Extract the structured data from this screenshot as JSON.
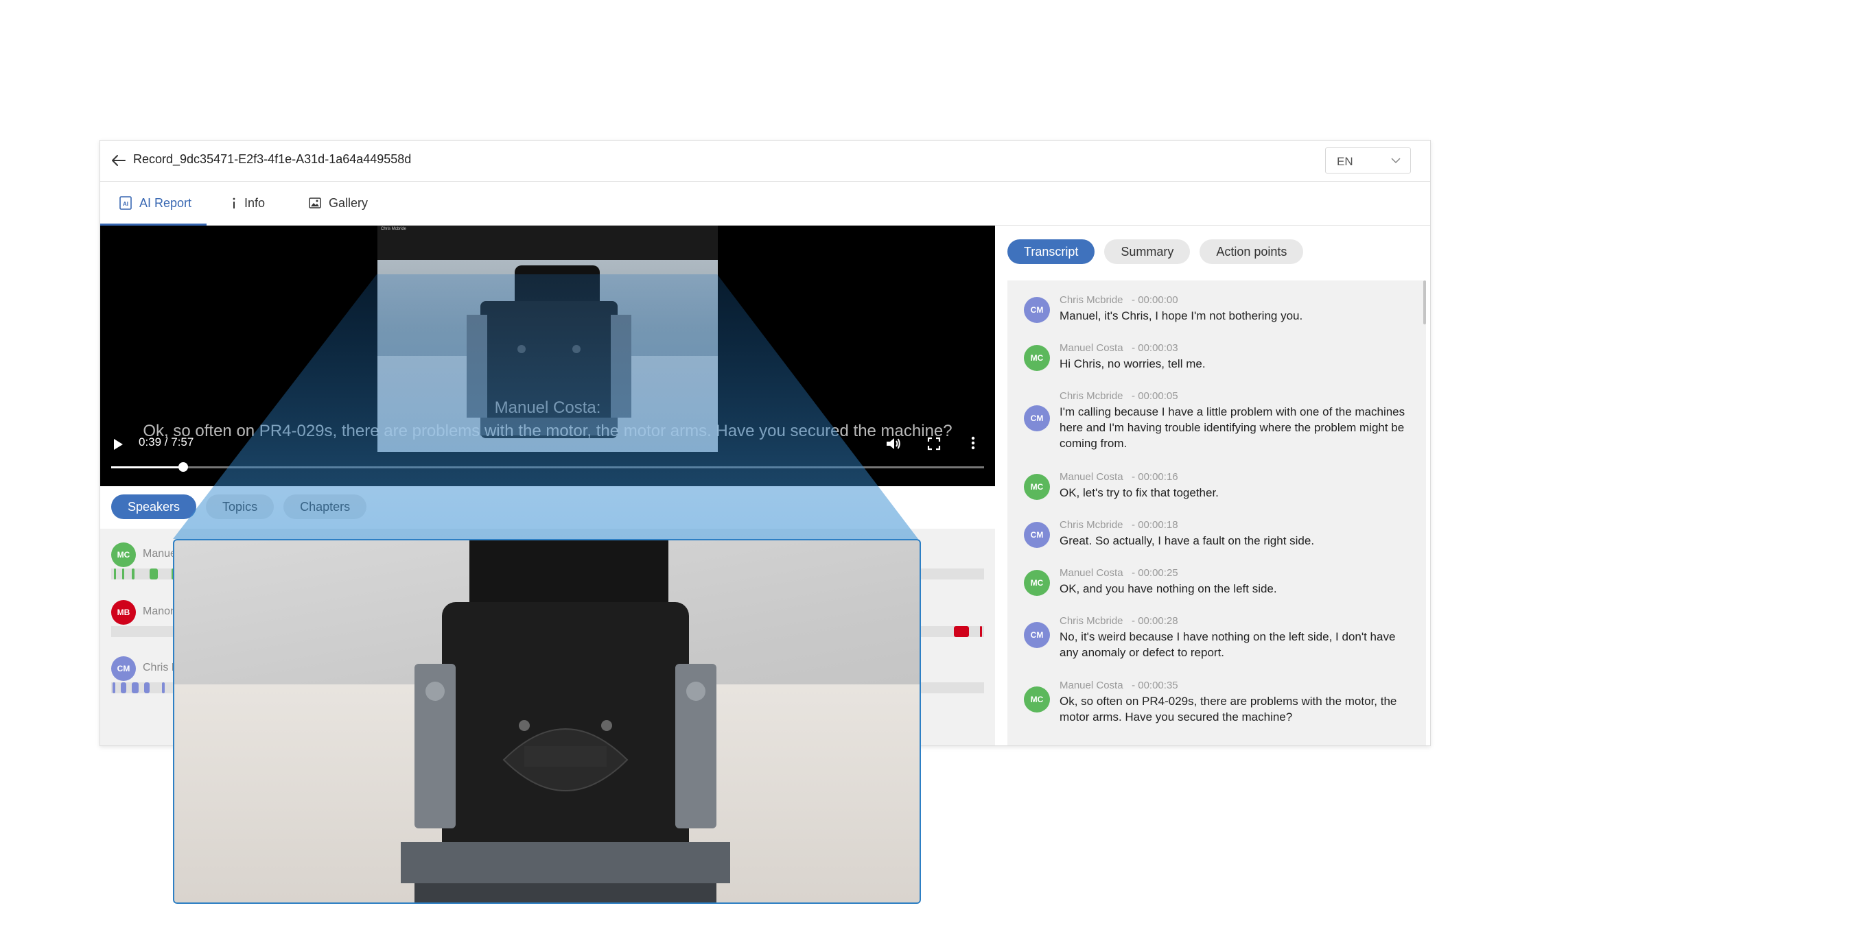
{
  "header": {
    "record_title": "Record_9dc35471-E2f3-4f1e-A31d-1a64a449558d",
    "language": "EN"
  },
  "tabs": [
    {
      "label": "AI Report",
      "icon": "ai-report-icon",
      "active": true
    },
    {
      "label": "Info",
      "icon": "info-icon",
      "active": false
    },
    {
      "label": "Gallery",
      "icon": "gallery-icon",
      "active": false
    }
  ],
  "video": {
    "camera_label": "Chris Mcbride",
    "subtitle_speaker": "Manuel Costa:",
    "subtitle_text": "Ok, so often on PR4-029s, there are problems with the motor, the motor arms. Have you secured the machine?",
    "time": "0:39 / 7:57",
    "progress": 0.0828
  },
  "analysis_tabs": [
    {
      "label": "Speakers",
      "active": true
    },
    {
      "label": "Topics",
      "active": false
    },
    {
      "label": "Chapters",
      "active": false
    }
  ],
  "speakers": [
    {
      "initials": "MC",
      "name": "Manuel Costa",
      "color": "#5cb85c"
    },
    {
      "initials": "MB",
      "name": "Manon Blanc",
      "color": "#d0021b"
    },
    {
      "initials": "CM",
      "name": "Chris Mcbride",
      "color": "#7f8bd6"
    }
  ],
  "transcript_tabs": [
    {
      "label": "Transcript",
      "active": true
    },
    {
      "label": "Summary",
      "active": false
    },
    {
      "label": "Action points",
      "active": false
    }
  ],
  "transcript": [
    {
      "initials": "CM",
      "speaker": "Chris Mcbride",
      "time": "- 00:00:00",
      "text": "Manuel, it's Chris, I hope I'm not bothering you."
    },
    {
      "initials": "MC",
      "speaker": "Manuel Costa",
      "time": "- 00:00:03",
      "text": "Hi Chris, no worries, tell me."
    },
    {
      "initials": "CM",
      "speaker": "Chris Mcbride",
      "time": "- 00:00:05",
      "text": "I'm calling because I have a little problem with one of the machines here and I'm having trouble identifying where the problem might be coming from."
    },
    {
      "initials": "MC",
      "speaker": "Manuel Costa",
      "time": "- 00:00:16",
      "text": "OK, let's try to fix that together."
    },
    {
      "initials": "CM",
      "speaker": "Chris Mcbride",
      "time": "- 00:00:18",
      "text": "Great. So actually, I have a fault on the right side."
    },
    {
      "initials": "MC",
      "speaker": "Manuel Costa",
      "time": "- 00:00:25",
      "text": "OK, and you have nothing on the left side."
    },
    {
      "initials": "CM",
      "speaker": "Chris Mcbride",
      "time": "- 00:00:28",
      "text": "No, it's weird because I have nothing on the left side, I don't have any anomaly or defect to report."
    },
    {
      "initials": "MC",
      "speaker": "Manuel Costa",
      "time": "- 00:00:35",
      "text": "Ok, so often on PR4-029s, there are problems with the motor, the motor arms. Have you secured the machine?"
    }
  ],
  "colors": {
    "accent": "#3f72bd",
    "mc": "#5cb85c",
    "mb": "#d0021b",
    "cm": "#7f8bd6",
    "zoom_border": "#2d7fc4"
  }
}
